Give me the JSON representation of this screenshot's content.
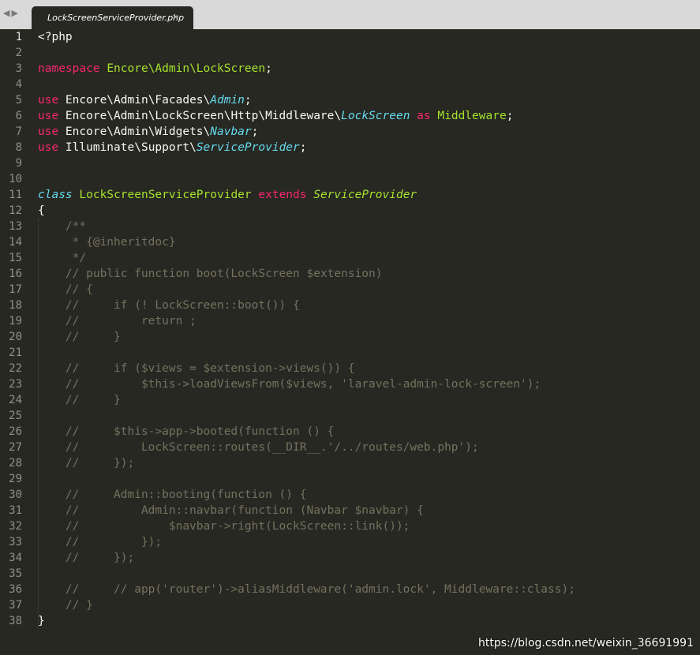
{
  "tab": {
    "nav_icon": "left-right-arrows-icon",
    "nav_glyph": "◀▶",
    "filename": "LockScreenServiceProvider.php",
    "close_glyph": "×"
  },
  "colors": {
    "background": "#272822",
    "keyword": "#f92672",
    "class_name": "#a6e22e",
    "type_italic": "#66d9ef",
    "comment": "#75715e",
    "text": "#f8f8f2"
  },
  "code": [
    {
      "n": "1",
      "t": [
        {
          "c": "plain",
          "s": "<?php"
        }
      ]
    },
    {
      "n": "2",
      "t": []
    },
    {
      "n": "3",
      "t": [
        {
          "c": "kw",
          "s": "namespace"
        },
        {
          "c": "plain",
          "s": " "
        },
        {
          "c": "cls",
          "s": "Encore\\Admin\\LockScreen"
        },
        {
          "c": "plain",
          "s": ";"
        }
      ]
    },
    {
      "n": "4",
      "t": []
    },
    {
      "n": "5",
      "t": [
        {
          "c": "kw",
          "s": "use"
        },
        {
          "c": "plain",
          "s": " Encore\\Admin\\Facades\\"
        },
        {
          "c": "it",
          "s": "Admin"
        },
        {
          "c": "plain",
          "s": ";"
        }
      ]
    },
    {
      "n": "6",
      "t": [
        {
          "c": "kw",
          "s": "use"
        },
        {
          "c": "plain",
          "s": " Encore\\Admin\\LockScreen\\Http\\Middleware\\"
        },
        {
          "c": "it",
          "s": "LockScreen"
        },
        {
          "c": "plain",
          "s": " "
        },
        {
          "c": "kw",
          "s": "as"
        },
        {
          "c": "plain",
          "s": " "
        },
        {
          "c": "cls",
          "s": "Middleware"
        },
        {
          "c": "plain",
          "s": ";"
        }
      ]
    },
    {
      "n": "7",
      "t": [
        {
          "c": "kw",
          "s": "use"
        },
        {
          "c": "plain",
          "s": " Encore\\Admin\\Widgets\\"
        },
        {
          "c": "it",
          "s": "Navbar"
        },
        {
          "c": "plain",
          "s": ";"
        }
      ]
    },
    {
      "n": "8",
      "t": [
        {
          "c": "kw",
          "s": "use"
        },
        {
          "c": "plain",
          "s": " Illuminate\\Support\\"
        },
        {
          "c": "it",
          "s": "ServiceProvider"
        },
        {
          "c": "plain",
          "s": ";"
        }
      ]
    },
    {
      "n": "9",
      "t": []
    },
    {
      "n": "10",
      "t": []
    },
    {
      "n": "11",
      "t": [
        {
          "c": "it",
          "s": "class"
        },
        {
          "c": "plain",
          "s": " "
        },
        {
          "c": "cls",
          "s": "LockScreenServiceProvider"
        },
        {
          "c": "plain",
          "s": " "
        },
        {
          "c": "kw",
          "s": "extends"
        },
        {
          "c": "plain",
          "s": " "
        },
        {
          "c": "itg",
          "s": "ServiceProvider"
        }
      ]
    },
    {
      "n": "12",
      "t": [
        {
          "c": "plain",
          "s": "{"
        }
      ]
    },
    {
      "n": "13",
      "t": [
        {
          "c": "cm",
          "s": "    /**"
        }
      ]
    },
    {
      "n": "14",
      "t": [
        {
          "c": "cm",
          "s": "     * {@inheritdoc}"
        }
      ]
    },
    {
      "n": "15",
      "t": [
        {
          "c": "cm",
          "s": "     */"
        }
      ]
    },
    {
      "n": "16",
      "t": [
        {
          "c": "cm",
          "s": "    // public function boot(LockScreen $extension)"
        }
      ]
    },
    {
      "n": "17",
      "t": [
        {
          "c": "cm",
          "s": "    // {"
        }
      ]
    },
    {
      "n": "18",
      "t": [
        {
          "c": "cm",
          "s": "    //     if (! LockScreen::boot()) {"
        }
      ]
    },
    {
      "n": "19",
      "t": [
        {
          "c": "cm",
          "s": "    //         return ;"
        }
      ]
    },
    {
      "n": "20",
      "t": [
        {
          "c": "cm",
          "s": "    //     }"
        }
      ]
    },
    {
      "n": "21",
      "t": []
    },
    {
      "n": "22",
      "t": [
        {
          "c": "cm",
          "s": "    //     if ($views = $extension->views()) {"
        }
      ]
    },
    {
      "n": "23",
      "t": [
        {
          "c": "cm",
          "s": "    //         $this->loadViewsFrom($views, 'laravel-admin-lock-screen');"
        }
      ]
    },
    {
      "n": "24",
      "t": [
        {
          "c": "cm",
          "s": "    //     }"
        }
      ]
    },
    {
      "n": "25",
      "t": []
    },
    {
      "n": "26",
      "t": [
        {
          "c": "cm",
          "s": "    //     $this->app->booted(function () {"
        }
      ]
    },
    {
      "n": "27",
      "t": [
        {
          "c": "cm",
          "s": "    //         LockScreen::routes(__DIR__.'/../routes/web.php');"
        }
      ]
    },
    {
      "n": "28",
      "t": [
        {
          "c": "cm",
          "s": "    //     });"
        }
      ]
    },
    {
      "n": "29",
      "t": []
    },
    {
      "n": "30",
      "t": [
        {
          "c": "cm",
          "s": "    //     Admin::booting(function () {"
        }
      ]
    },
    {
      "n": "31",
      "t": [
        {
          "c": "cm",
          "s": "    //         Admin::navbar(function (Navbar $navbar) {"
        }
      ]
    },
    {
      "n": "32",
      "t": [
        {
          "c": "cm",
          "s": "    //             $navbar->right(LockScreen::link());"
        }
      ]
    },
    {
      "n": "33",
      "t": [
        {
          "c": "cm",
          "s": "    //         });"
        }
      ]
    },
    {
      "n": "34",
      "t": [
        {
          "c": "cm",
          "s": "    //     });"
        }
      ]
    },
    {
      "n": "35",
      "t": []
    },
    {
      "n": "36",
      "t": [
        {
          "c": "cm",
          "s": "    //     // app('router')->aliasMiddleware('admin.lock', Middleware::class);"
        }
      ]
    },
    {
      "n": "37",
      "t": [
        {
          "c": "cm",
          "s": "    // }"
        }
      ]
    },
    {
      "n": "38",
      "t": [
        {
          "c": "plain",
          "s": "}"
        }
      ]
    }
  ],
  "watermark": "https://blog.csdn.net/weixin_36691991"
}
